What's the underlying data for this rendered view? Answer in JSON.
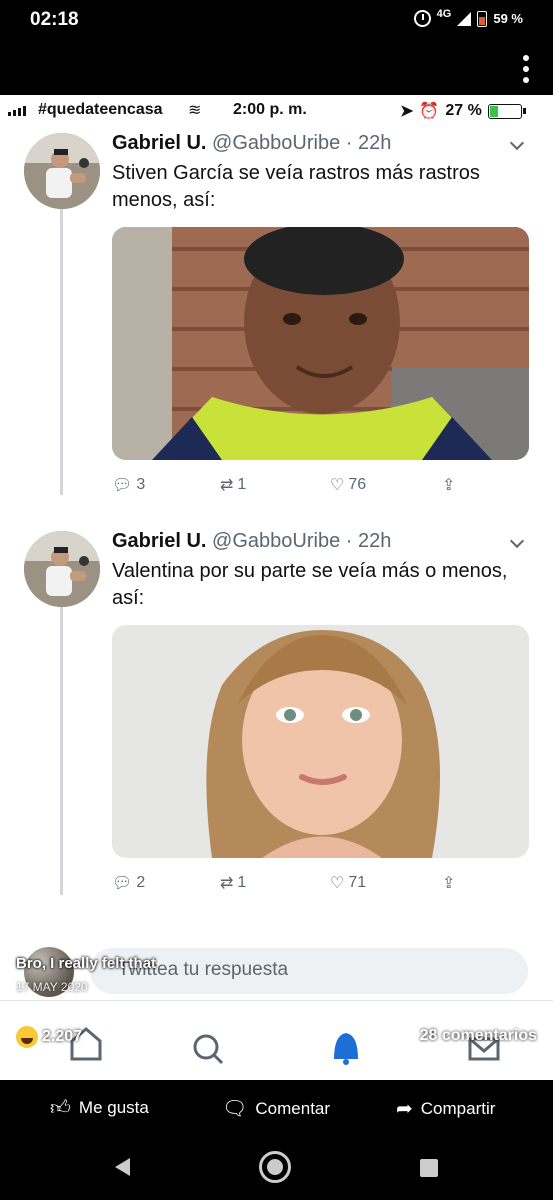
{
  "phone_status": {
    "time": "02:18",
    "network": "4G",
    "battery": "59 %"
  },
  "twitter_status": {
    "carrier": "#quedateencasa",
    "time": "2:00 p. m.",
    "battery": "27 %"
  },
  "tweets": [
    {
      "name": "Gabriel U.",
      "handle": "@GabboUribe",
      "time": "· 22h",
      "text": "Stiven García se veía rastros más rastros menos, así:",
      "replies": "3",
      "retweets": "1",
      "likes": "76"
    },
    {
      "name": "Gabriel U.",
      "handle": "@GabboUribe",
      "time": "· 22h",
      "text": "Valentina por su parte se veía más o menos, así:",
      "replies": "2",
      "retweets": "1",
      "likes": "71"
    }
  ],
  "reply_placeholder": "Twittea tu respuesta",
  "facebook": {
    "poster_name": "Bro, I really felt that",
    "post_date": "17 MAY 2020",
    "reactions_count": "2.207",
    "comments_count": "28 comentarios",
    "actions": {
      "like": "Me gusta",
      "comment": "Comentar",
      "share": "Compartir"
    }
  }
}
